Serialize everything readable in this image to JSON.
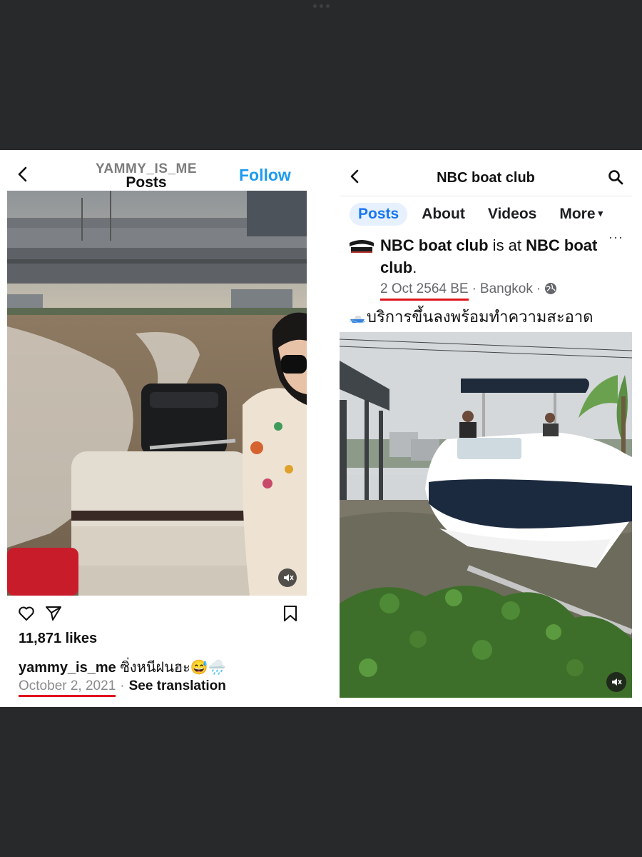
{
  "instagram": {
    "username": "YAMMY_IS_ME",
    "header_title": "Posts",
    "follow_label": "Follow",
    "likes": "11,871 likes",
    "caption_user": "yammy_is_me",
    "caption_text": " ซิ่งหนีฝนฮะ😅🌧️",
    "date": "October 2, 2021",
    "separator": "·",
    "translate_label": "See translation",
    "icons": [
      "back-icon",
      "heart-icon",
      "send-icon",
      "bookmark-icon",
      "mute-icon"
    ]
  },
  "facebook": {
    "page_title": "NBC boat club",
    "tabs": [
      {
        "label": "Posts"
      },
      {
        "label": "About"
      },
      {
        "label": "Videos"
      },
      {
        "label": "More"
      }
    ],
    "more_caret": "▾",
    "post_author": "NBC boat club",
    "post_mid": " is at ",
    "post_place": "NBC boat club",
    "post_end": ".",
    "more_dots": "···",
    "date": "2 Oct 2564 BE",
    "separator": "·",
    "location": "Bangkok",
    "text": "บริการขึ้นลงพร้อมทำความสะอาด",
    "icons": [
      "back-icon",
      "search-icon",
      "page-logo",
      "globe-icon",
      "speedboat-icon",
      "mute-icon"
    ]
  },
  "colors": {
    "follow_blue": "#1d9bf0",
    "fb_blue": "#1877f2",
    "highlight_red": "#e0141d",
    "frame_dark": "#28292b"
  }
}
